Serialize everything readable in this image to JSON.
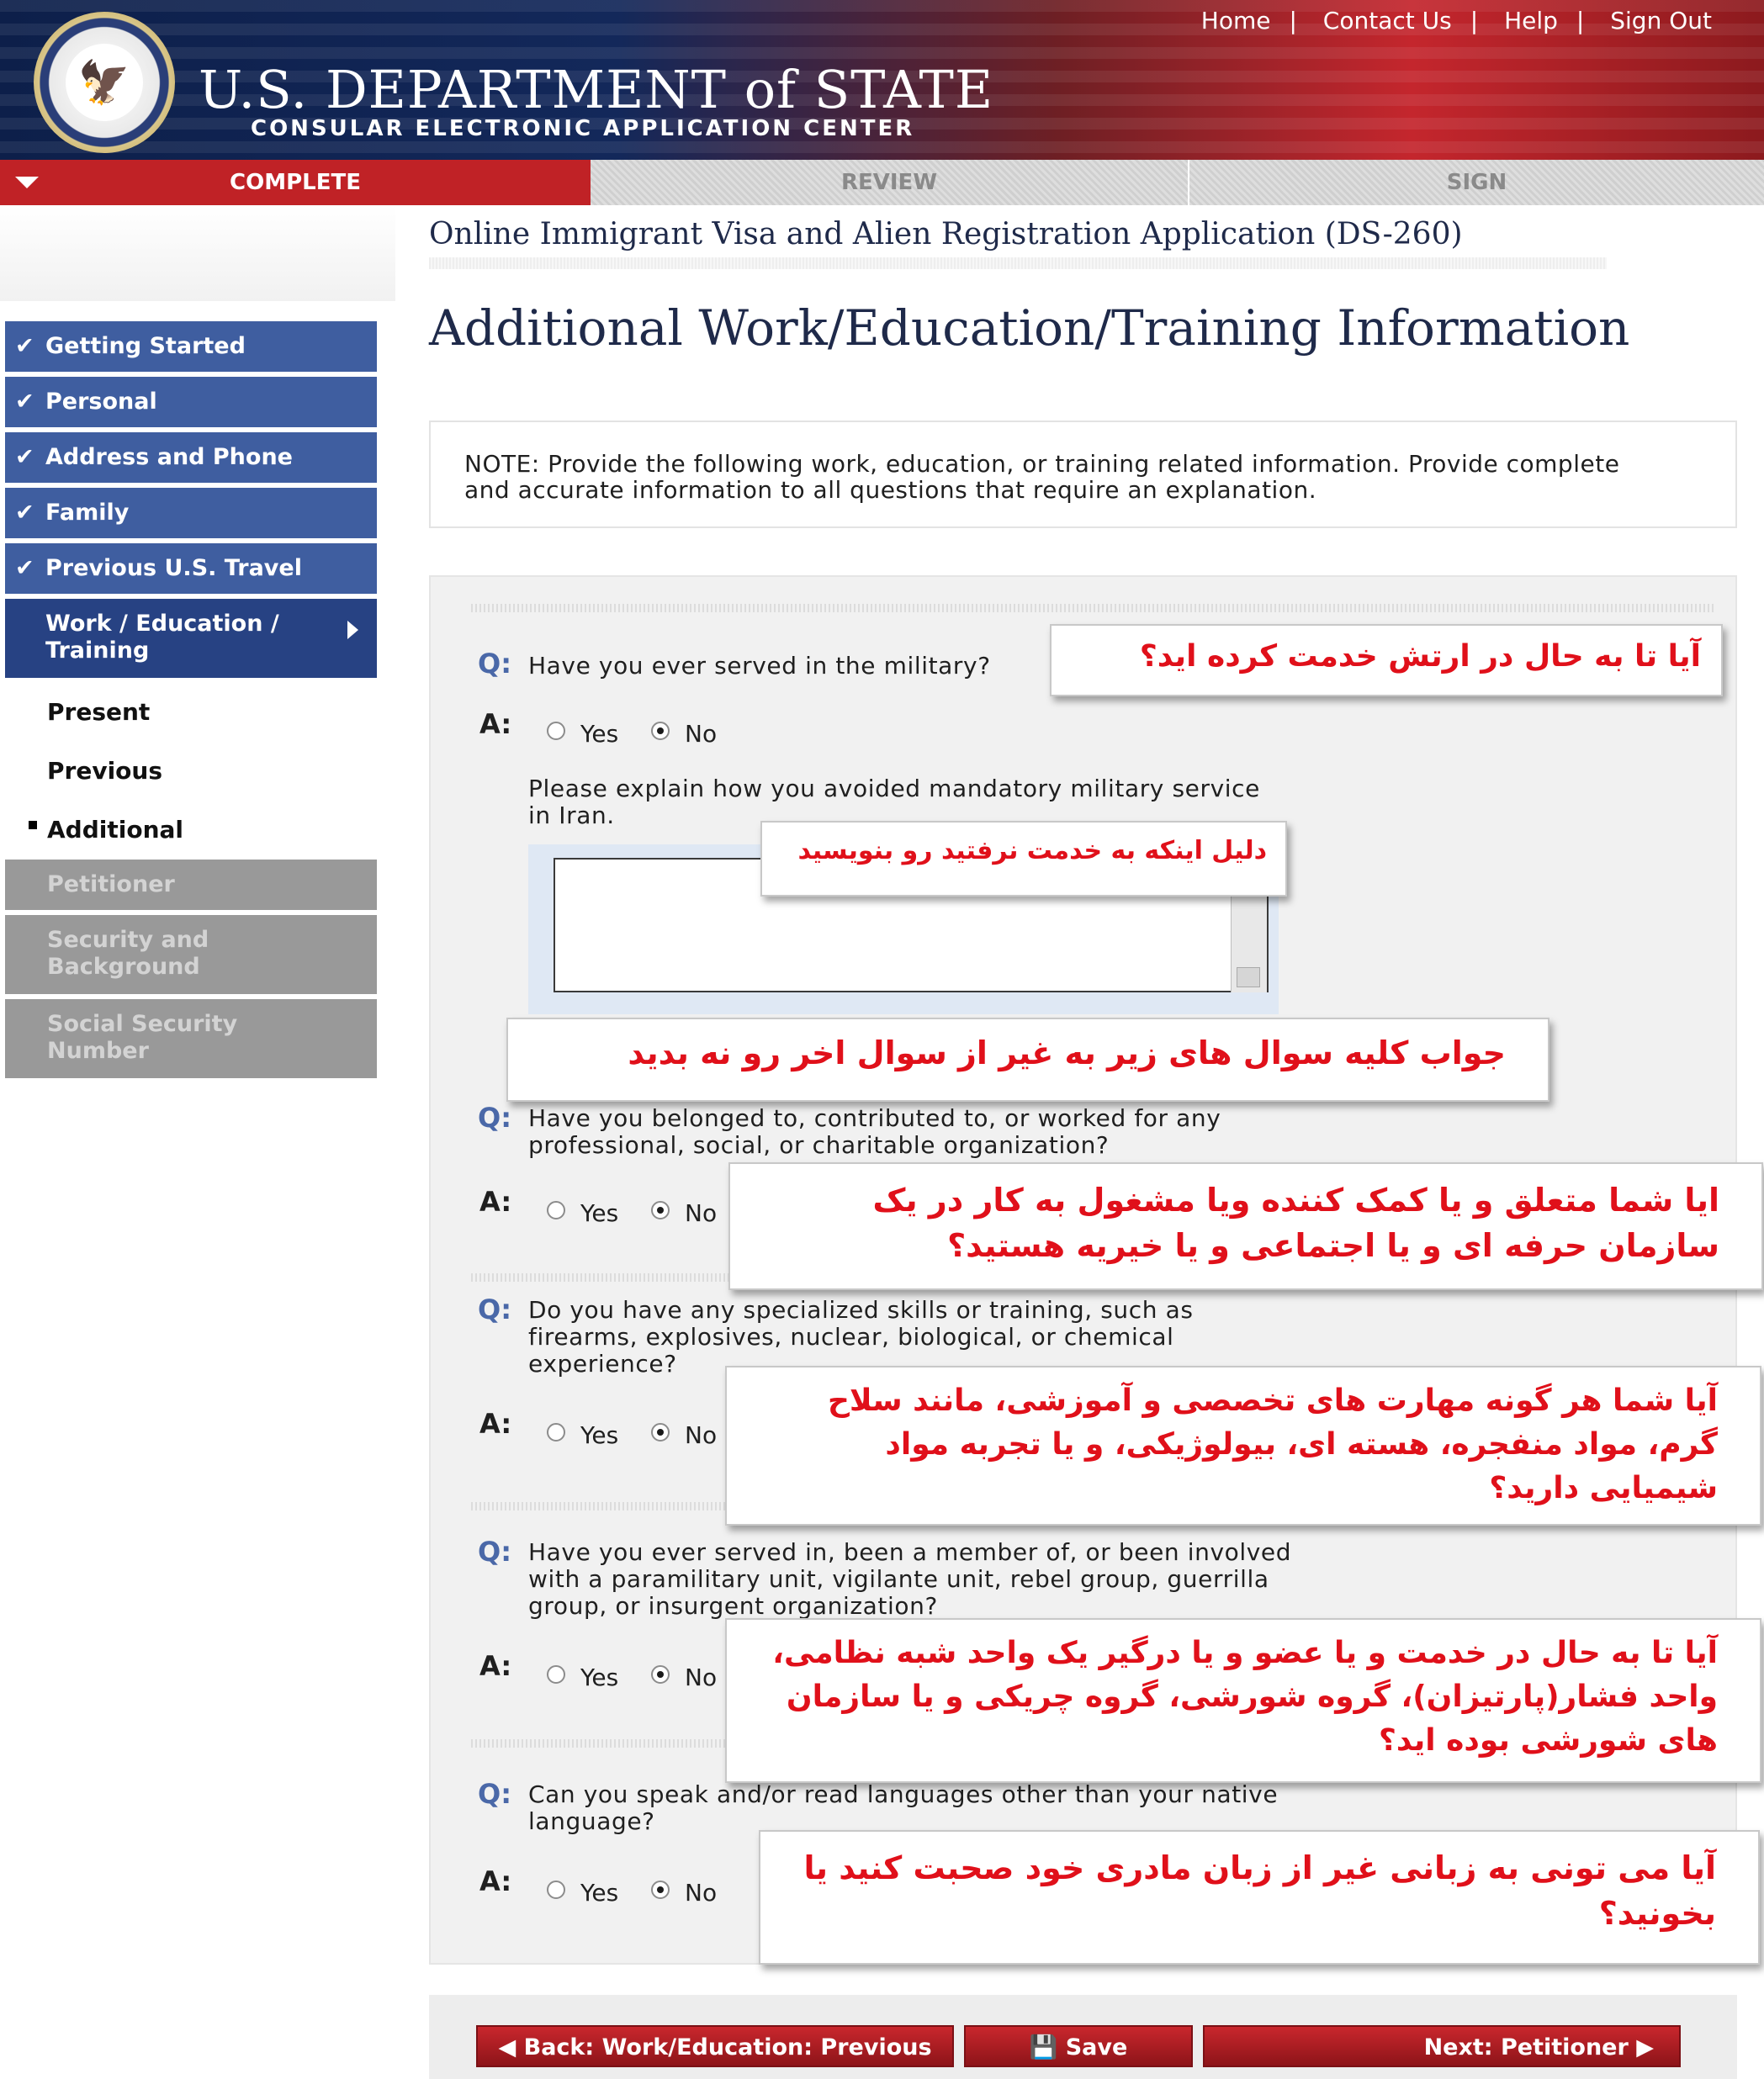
{
  "header": {
    "top_nav": [
      "Home",
      "Contact Us",
      "Help",
      "Sign Out"
    ],
    "brand_title": "U.S. DEPARTMENT of STATE",
    "brand_subtitle": "CONSULAR ELECTRONIC APPLICATION CENTER",
    "seal_icon": "eagle-seal-icon"
  },
  "progress": {
    "steps": [
      "COMPLETE",
      "REVIEW",
      "SIGN"
    ],
    "active": "COMPLETE"
  },
  "form_title": "Online Immigrant Visa and Alien Registration Application (DS-260)",
  "page_heading": "Additional Work/Education/Training Information",
  "sidebar": {
    "items": [
      {
        "label": "Getting Started",
        "state": "done"
      },
      {
        "label": "Personal",
        "state": "done"
      },
      {
        "label": "Address and Phone",
        "state": "done"
      },
      {
        "label": "Family",
        "state": "done"
      },
      {
        "label": "Previous U.S. Travel",
        "state": "done"
      },
      {
        "label": "Work / Education / Training",
        "state": "current"
      },
      {
        "label": "Petitioner",
        "state": "disabled"
      },
      {
        "label": "Security and Background",
        "state": "disabled"
      },
      {
        "label": "Social Security Number",
        "state": "disabled"
      }
    ],
    "subitems": [
      "Present",
      "Previous",
      "Additional"
    ],
    "current_subitem": "Additional"
  },
  "note": "NOTE: Provide the following work, education, or training related information. Provide complete and accurate information to all questions that require an explanation.",
  "questions": [
    {
      "q": "Have you ever served in the military?",
      "answer": "No"
    },
    {
      "q": "Have you belonged to, contributed to, or worked for any professional, social, or charitable organization?",
      "answer": "No"
    },
    {
      "q": "Do you have any specialized skills or training, such as firearms, explosives, nuclear, biological, or chemical experience?",
      "answer": "No"
    },
    {
      "q": "Have you ever served in, been a member of, or been involved with a paramilitary unit, vigilante unit, rebel group, guerrilla group, or insurgent organization?",
      "answer": "No"
    },
    {
      "q": "Can you speak and/or read languages other than your native language?",
      "answer": "No"
    }
  ],
  "q_prefix": "Q:",
  "a_prefix": "A:",
  "yes_label": "Yes",
  "no_label": "No",
  "explain_prompt": "Please explain how you avoided mandatory military service in Iran.",
  "explain_value": "",
  "annotations": [
    "آیا تا به حال در ارتش خدمت کرده اید؟",
    "دلیل اینکه به خدمت نرفتید رو بنویسید",
    "جواب کلیه سوال های زیر به غیر از سوال اخر رو نه بدید",
    "ایا شما متعلق و یا کمک کننده ویا مشغول به کار در یک سازمان حرفه ای و یا اجتماعی و یا خیریه هستید؟",
    "آیا شما هر گونه مهارت های تخصصی و آموزشی، مانند سلاح گرم، مواد منفجره، هسته ای، بیولوژیکی، و یا تجربه مواد شیمیایی دارید؟",
    "آیا تا به حال در خدمت و یا عضو و یا درگیر یک واحد شبه نظامی، واحد فشار(پارتیزان)، گروه شورشی، گروه چریکی و یا سازمان های شورشی بوده اید؟",
    "آیا می تونی به زبانی غیر از زبان مادری خود صحبت کنید یا بخونید؟"
  ],
  "buttons": {
    "back": "Back: Work/Education: Previous",
    "save": "Save",
    "next": "Next: Petitioner"
  },
  "colors": {
    "nav_blue": "#3f5ea0",
    "nav_current": "#274283",
    "red": "#c02226",
    "annotation_red": "#e0101a"
  }
}
